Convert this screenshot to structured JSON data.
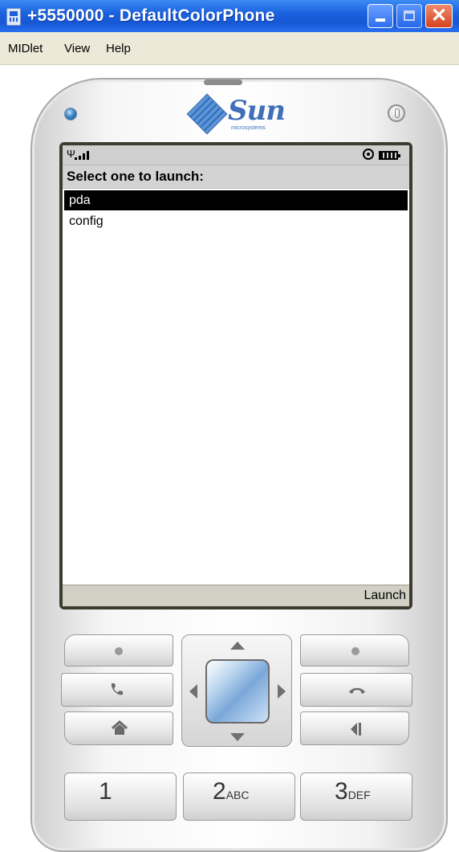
{
  "window": {
    "title": "+5550000 - DefaultColorPhone",
    "minimize_icon": "minimize-icon",
    "maximize_icon": "maximize-icon",
    "close_icon": "close-icon",
    "close_glyph": "✕"
  },
  "menubar": {
    "items": [
      "MIDlet",
      "View",
      "Help"
    ]
  },
  "phone": {
    "logo_text": "Sun",
    "logo_sub": "microsystems",
    "screen": {
      "title": "Select one to launch:",
      "list": [
        {
          "label": "pda",
          "selected": true
        },
        {
          "label": "config",
          "selected": false
        }
      ],
      "right_softkey": "Launch"
    },
    "keypad": {
      "keys": [
        {
          "num": "1",
          "sub": ""
        },
        {
          "num": "2",
          "sub": "ABC"
        },
        {
          "num": "3",
          "sub": "DEF"
        }
      ]
    }
  },
  "colors": {
    "titlebar": "#1c63e0",
    "selection": "#000000",
    "dpad_center": "#7aa7d9"
  }
}
